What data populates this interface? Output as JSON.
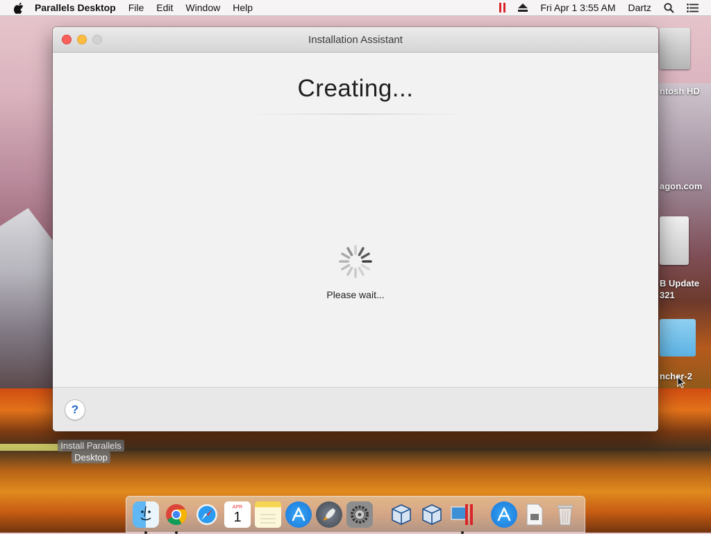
{
  "menubar": {
    "app_name": "Parallels Desktop",
    "menus": [
      "File",
      "Edit",
      "Window",
      "Help"
    ],
    "datetime": "Fri Apr 1  3:55 AM",
    "user": "Dartz"
  },
  "desktop": {
    "icons": [
      {
        "label": "ntosh HD"
      },
      {
        "label": "agon.com"
      },
      {
        "label_line1": "B Update",
        "label_line2": "321"
      },
      {
        "label": "ncher-2"
      }
    ],
    "installer": {
      "line1": "Install Parallels",
      "line2": "Desktop"
    }
  },
  "window": {
    "title": "Installation Assistant",
    "heading": "Creating...",
    "status": "Please wait..."
  },
  "footer": {
    "help_label": "?"
  },
  "dock": {
    "calendar_month": "APR",
    "calendar_day": "1",
    "items": [
      "finder-icon",
      "chrome-icon",
      "safari-icon",
      "calendar-icon",
      "notes-icon",
      "app-store-icon",
      "launchpad-icon",
      "system-preferences-icon",
      "virtualbox-icon",
      "virtualbox-icon",
      "parallels-icon",
      "app-store-icon",
      "preview-document-icon",
      "trash-icon"
    ]
  },
  "colors": {
    "traffic_close": "#fc605c",
    "traffic_minimize": "#fdbc40",
    "parallels_red": "#d8262b",
    "help_blue": "#2166c7"
  }
}
